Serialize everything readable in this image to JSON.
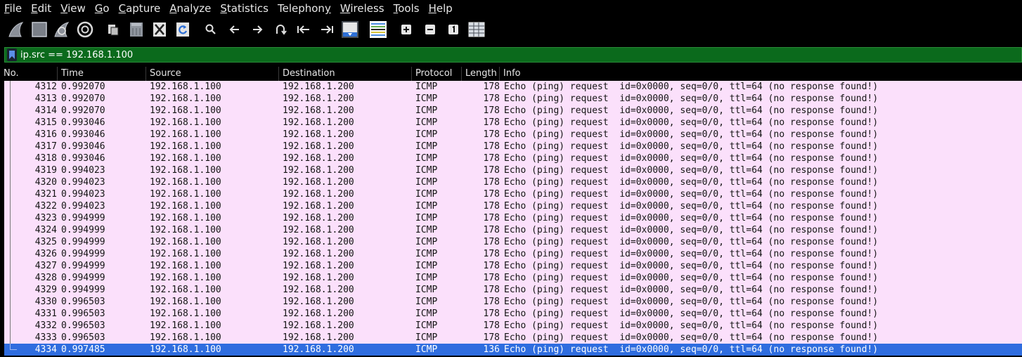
{
  "menu": [
    "File",
    "Edit",
    "View",
    "Go",
    "Capture",
    "Analyze",
    "Statistics",
    "Telephony",
    "Wireless",
    "Tools",
    "Help"
  ],
  "menu_underline": [
    "F",
    "E",
    "V",
    "G",
    "C",
    "A",
    "S",
    "y",
    "W",
    "T",
    "H"
  ],
  "toolbar": {
    "icons": [
      "start-capture-icon",
      "stop-capture-icon",
      "restart-capture-icon",
      "capture-options-icon",
      "open-file-icon",
      "save-file-icon",
      "close-file-icon",
      "reload-file-icon",
      "find-packet-icon",
      "go-back-icon",
      "go-forward-icon",
      "go-to-packet-icon",
      "previous-packet-icon",
      "next-packet-icon",
      "auto-scroll-icon",
      "colorize-icon",
      "zoom-in-icon",
      "zoom-out-icon",
      "normal-size-icon",
      "resize-columns-icon"
    ]
  },
  "filter": {
    "value": "ip.src == 192.168.1.100"
  },
  "colors": {
    "filter_valid": "#0b6a1c",
    "row_icmp": "#fbe0fb",
    "row_selected": "#2f6ddf"
  },
  "columns": [
    "No.",
    "Time",
    "Source",
    "Destination",
    "Protocol",
    "Length",
    "Info"
  ],
  "packets": [
    {
      "no": "4312",
      "time": "0.992070",
      "source": "192.168.1.100",
      "destination": "192.168.1.200",
      "protocol": "ICMP",
      "length": "178",
      "info": "Echo (ping) request  id=0x0000, seq=0/0, ttl=64 (no response found!)"
    },
    {
      "no": "4313",
      "time": "0.992070",
      "source": "192.168.1.100",
      "destination": "192.168.1.200",
      "protocol": "ICMP",
      "length": "178",
      "info": "Echo (ping) request  id=0x0000, seq=0/0, ttl=64 (no response found!)"
    },
    {
      "no": "4314",
      "time": "0.992070",
      "source": "192.168.1.100",
      "destination": "192.168.1.200",
      "protocol": "ICMP",
      "length": "178",
      "info": "Echo (ping) request  id=0x0000, seq=0/0, ttl=64 (no response found!)"
    },
    {
      "no": "4315",
      "time": "0.993046",
      "source": "192.168.1.100",
      "destination": "192.168.1.200",
      "protocol": "ICMP",
      "length": "178",
      "info": "Echo (ping) request  id=0x0000, seq=0/0, ttl=64 (no response found!)"
    },
    {
      "no": "4316",
      "time": "0.993046",
      "source": "192.168.1.100",
      "destination": "192.168.1.200",
      "protocol": "ICMP",
      "length": "178",
      "info": "Echo (ping) request  id=0x0000, seq=0/0, ttl=64 (no response found!)"
    },
    {
      "no": "4317",
      "time": "0.993046",
      "source": "192.168.1.100",
      "destination": "192.168.1.200",
      "protocol": "ICMP",
      "length": "178",
      "info": "Echo (ping) request  id=0x0000, seq=0/0, ttl=64 (no response found!)"
    },
    {
      "no": "4318",
      "time": "0.993046",
      "source": "192.168.1.100",
      "destination": "192.168.1.200",
      "protocol": "ICMP",
      "length": "178",
      "info": "Echo (ping) request  id=0x0000, seq=0/0, ttl=64 (no response found!)"
    },
    {
      "no": "4319",
      "time": "0.994023",
      "source": "192.168.1.100",
      "destination": "192.168.1.200",
      "protocol": "ICMP",
      "length": "178",
      "info": "Echo (ping) request  id=0x0000, seq=0/0, ttl=64 (no response found!)"
    },
    {
      "no": "4320",
      "time": "0.994023",
      "source": "192.168.1.100",
      "destination": "192.168.1.200",
      "protocol": "ICMP",
      "length": "178",
      "info": "Echo (ping) request  id=0x0000, seq=0/0, ttl=64 (no response found!)"
    },
    {
      "no": "4321",
      "time": "0.994023",
      "source": "192.168.1.100",
      "destination": "192.168.1.200",
      "protocol": "ICMP",
      "length": "178",
      "info": "Echo (ping) request  id=0x0000, seq=0/0, ttl=64 (no response found!)"
    },
    {
      "no": "4322",
      "time": "0.994023",
      "source": "192.168.1.100",
      "destination": "192.168.1.200",
      "protocol": "ICMP",
      "length": "178",
      "info": "Echo (ping) request  id=0x0000, seq=0/0, ttl=64 (no response found!)"
    },
    {
      "no": "4323",
      "time": "0.994999",
      "source": "192.168.1.100",
      "destination": "192.168.1.200",
      "protocol": "ICMP",
      "length": "178",
      "info": "Echo (ping) request  id=0x0000, seq=0/0, ttl=64 (no response found!)"
    },
    {
      "no": "4324",
      "time": "0.994999",
      "source": "192.168.1.100",
      "destination": "192.168.1.200",
      "protocol": "ICMP",
      "length": "178",
      "info": "Echo (ping) request  id=0x0000, seq=0/0, ttl=64 (no response found!)"
    },
    {
      "no": "4325",
      "time": "0.994999",
      "source": "192.168.1.100",
      "destination": "192.168.1.200",
      "protocol": "ICMP",
      "length": "178",
      "info": "Echo (ping) request  id=0x0000, seq=0/0, ttl=64 (no response found!)"
    },
    {
      "no": "4326",
      "time": "0.994999",
      "source": "192.168.1.100",
      "destination": "192.168.1.200",
      "protocol": "ICMP",
      "length": "178",
      "info": "Echo (ping) request  id=0x0000, seq=0/0, ttl=64 (no response found!)"
    },
    {
      "no": "4327",
      "time": "0.994999",
      "source": "192.168.1.100",
      "destination": "192.168.1.200",
      "protocol": "ICMP",
      "length": "178",
      "info": "Echo (ping) request  id=0x0000, seq=0/0, ttl=64 (no response found!)"
    },
    {
      "no": "4328",
      "time": "0.994999",
      "source": "192.168.1.100",
      "destination": "192.168.1.200",
      "protocol": "ICMP",
      "length": "178",
      "info": "Echo (ping) request  id=0x0000, seq=0/0, ttl=64 (no response found!)"
    },
    {
      "no": "4329",
      "time": "0.994999",
      "source": "192.168.1.100",
      "destination": "192.168.1.200",
      "protocol": "ICMP",
      "length": "178",
      "info": "Echo (ping) request  id=0x0000, seq=0/0, ttl=64 (no response found!)"
    },
    {
      "no": "4330",
      "time": "0.996503",
      "source": "192.168.1.100",
      "destination": "192.168.1.200",
      "protocol": "ICMP",
      "length": "178",
      "info": "Echo (ping) request  id=0x0000, seq=0/0, ttl=64 (no response found!)"
    },
    {
      "no": "4331",
      "time": "0.996503",
      "source": "192.168.1.100",
      "destination": "192.168.1.200",
      "protocol": "ICMP",
      "length": "178",
      "info": "Echo (ping) request  id=0x0000, seq=0/0, ttl=64 (no response found!)"
    },
    {
      "no": "4332",
      "time": "0.996503",
      "source": "192.168.1.100",
      "destination": "192.168.1.200",
      "protocol": "ICMP",
      "length": "178",
      "info": "Echo (ping) request  id=0x0000, seq=0/0, ttl=64 (no response found!)"
    },
    {
      "no": "4333",
      "time": "0.996503",
      "source": "192.168.1.100",
      "destination": "192.168.1.200",
      "protocol": "ICMP",
      "length": "178",
      "info": "Echo (ping) request  id=0x0000, seq=0/0, ttl=64 (no response found!)"
    },
    {
      "no": "4334",
      "time": "0.997485",
      "source": "192.168.1.100",
      "destination": "192.168.1.200",
      "protocol": "ICMP",
      "length": "136",
      "info": "Echo (ping) request  id=0x0000, seq=0/0, ttl=64 (no response found!)",
      "selected": true
    }
  ]
}
